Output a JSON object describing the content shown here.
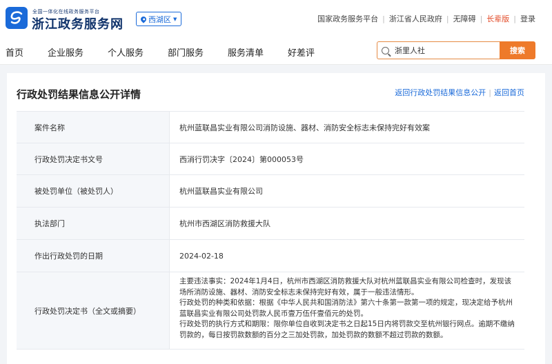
{
  "header": {
    "brand_small": "全国一体化在线政务服务平台",
    "brand_big": "浙江政务服务网",
    "region": "西湖区",
    "top_links": [
      "国家政务服务平台",
      "浙江省人民政府",
      "无障碍",
      "长辈版",
      "登录"
    ]
  },
  "nav": {
    "items": [
      "首页",
      "企业服务",
      "个人服务",
      "部门服务",
      "服务清单",
      "好差评"
    ]
  },
  "search": {
    "value": "浙里人社",
    "button": "搜索"
  },
  "page": {
    "title": "行政处罚结果信息公开详情",
    "back_list": "返回行政处罚结果信息公开",
    "back_home": "返回首页"
  },
  "table": {
    "rows": [
      {
        "label": "案件名称",
        "value": "杭州蓝联昌实业有限公司消防设施、器材、消防安全标志未保持完好有效案"
      },
      {
        "label": "行政处罚决定书文号",
        "value": "西消行罚决字〔2024〕第000053号"
      },
      {
        "label": "被处罚单位（被处罚人）",
        "value": "杭州蓝联昌实业有限公司"
      },
      {
        "label": "执法部门",
        "value": "杭州市西湖区消防救援大队"
      },
      {
        "label": "作出行政处罚的日期",
        "value": "2024-02-18"
      },
      {
        "label": "行政处罚决定书（全文或摘要）",
        "paragraphs": [
          "主要违法事实：2024年1月4日，杭州市西湖区消防救援大队对杭州蓝联昌实业有限公司检查时，发现该场所消防设施、器材、消防安全标志未保持完好有效，属于一般违法情形。",
          "行政处罚的种类和依据：根据《中华人民共和国消防法》第六十条第一款第一项的规定，现决定给予杭州蓝联昌实业有限公司处罚款人民币壹万伍仟壹佰元的处罚。",
          "行政处罚的执行方式和期限：限你单位自收到决定书之日起15日内将罚款交至杭州银行网点。逾期不缴纳罚款的，每日按罚款数额的百分之三加处罚款，加处罚款的数额不超过罚款的数额。"
        ]
      }
    ]
  },
  "colors": {
    "primary": "#1a6ad9",
    "accent": "#ee7a2a",
    "elder": "#e34d2b"
  }
}
